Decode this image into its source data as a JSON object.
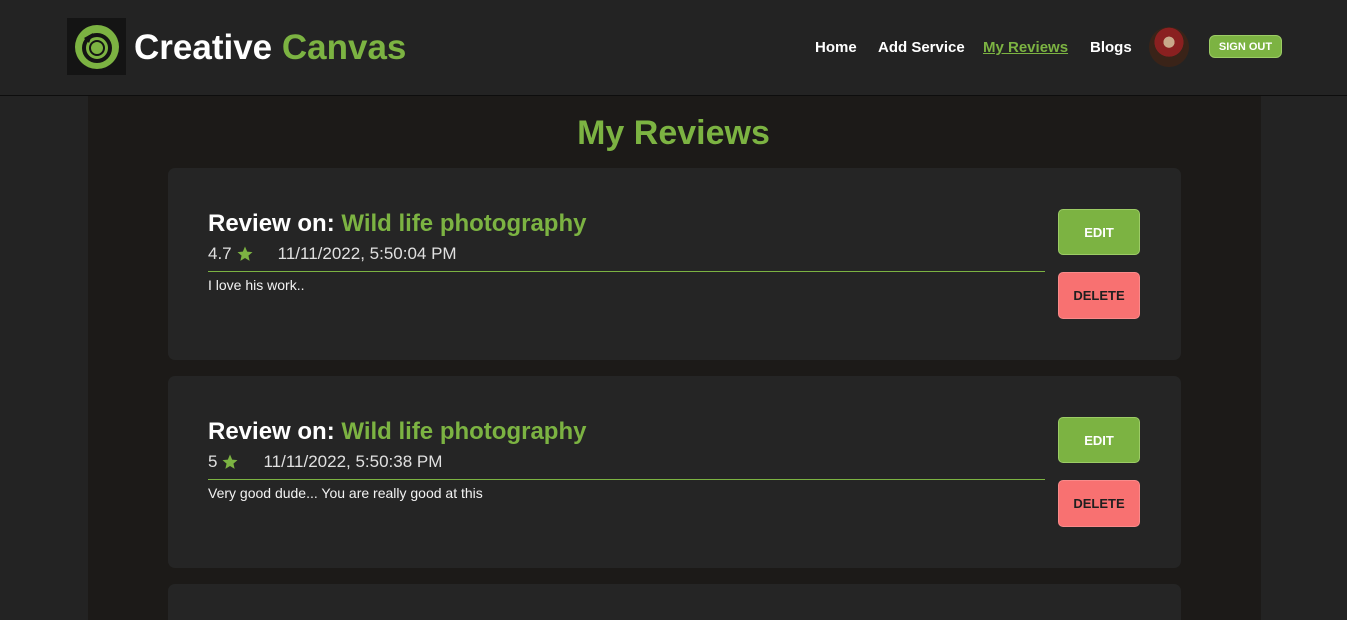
{
  "brand": {
    "name_part1": "Creative",
    "name_part2": "Canvas",
    "logo_icon": "camera-lens-icon"
  },
  "nav": {
    "items": [
      {
        "label": "Home"
      },
      {
        "label": "Add Service"
      },
      {
        "label": "My Reviews",
        "active": true
      },
      {
        "label": "Blogs"
      }
    ],
    "signout_label": "SIGN OUT"
  },
  "page": {
    "title": "My Reviews"
  },
  "reviews": [
    {
      "prefix": "Review on:",
      "service": "Wild life photography",
      "rating": "4.7",
      "timestamp": "11/11/2022, 5:50:04 PM",
      "comment": "I love his work..",
      "edit_label": "EDIT",
      "delete_label": "DELETE"
    },
    {
      "prefix": "Review on:",
      "service": "Wild life photography",
      "rating": "5",
      "timestamp": "11/11/2022, 5:50:38 PM",
      "comment": "Very good dude... You are really good at this",
      "edit_label": "EDIT",
      "delete_label": "DELETE"
    }
  ],
  "colors": {
    "accent": "#7cb342",
    "danger": "#f87171",
    "background": "#232323",
    "card": "#252525"
  }
}
